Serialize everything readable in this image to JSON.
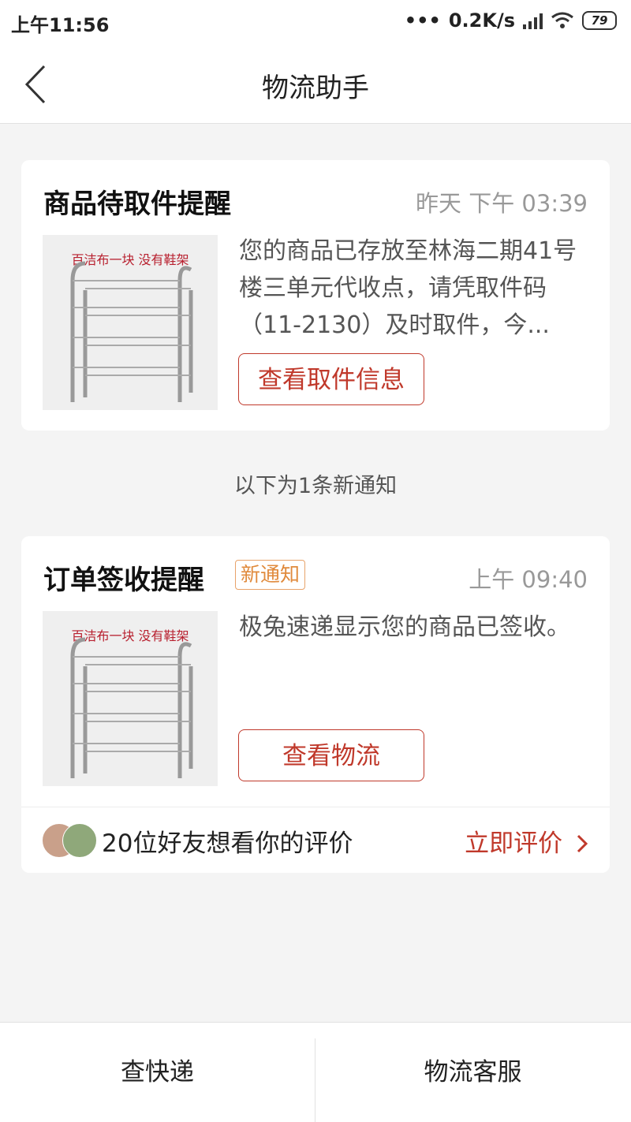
{
  "status_bar": {
    "time": "上午11:56",
    "network_speed": "0.2K/s",
    "battery": "79"
  },
  "header": {
    "title": "物流助手"
  },
  "cards": [
    {
      "title": "商品待取件提醒",
      "time": "昨天 下午 03:39",
      "image_caption": "百洁布一块 没有鞋架",
      "description": "您的商品已存放至林海二期41号楼三单元代收点，请凭取件码（11-2130）及时取件，今...",
      "button_label": "查看取件信息"
    },
    {
      "title": "订单签收提醒",
      "badge": "新通知",
      "time": "上午 09:40",
      "image_caption": "百洁布一块 没有鞋架",
      "description": "极兔速递显示您的商品已签收。",
      "button_label": "查看物流"
    }
  ],
  "new_notice_divider": "以下为1条新通知",
  "review_prompt": {
    "text": "20位好友想看你的评价",
    "action": "立即评价"
  },
  "bottom_tabs": [
    "查快递",
    "物流客服"
  ]
}
